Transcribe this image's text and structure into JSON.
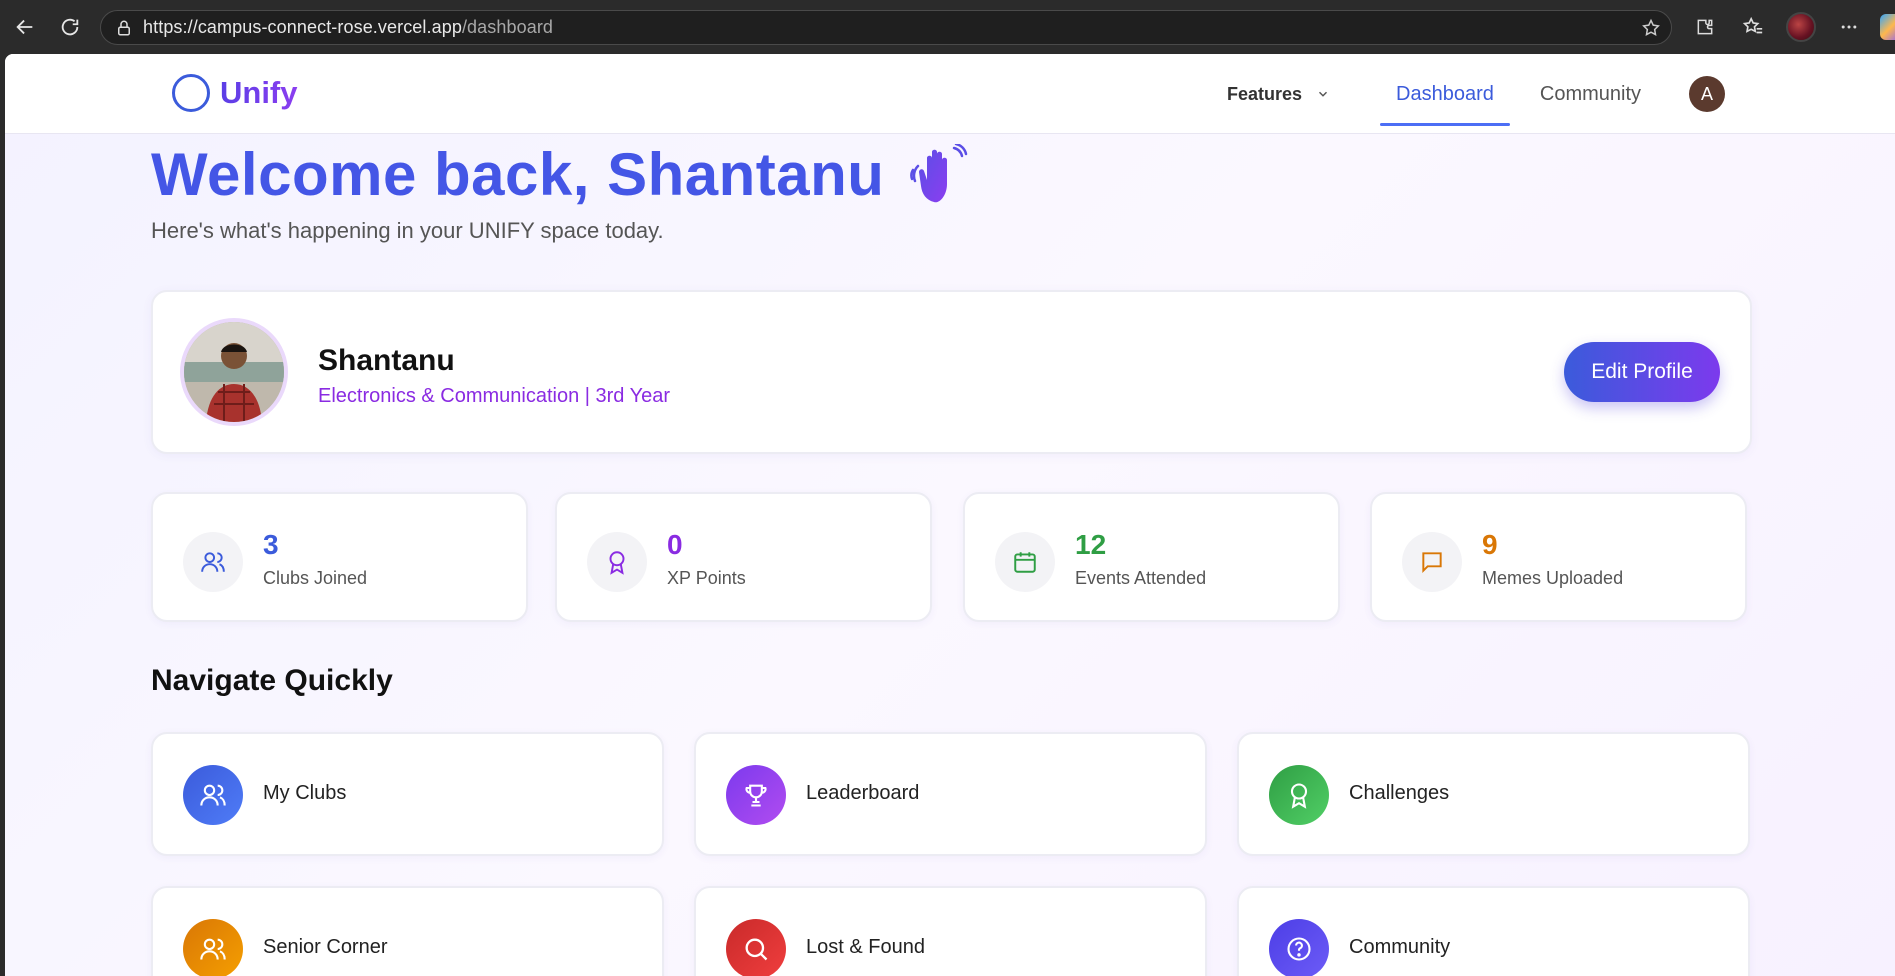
{
  "browser": {
    "url_host": "https://campus-connect-rose.vercel.app",
    "url_path": "/dashboard"
  },
  "nav": {
    "logo": "Unify",
    "features": "Features",
    "dashboard": "Dashboard",
    "community": "Community",
    "avatar_initial": "A"
  },
  "welcome": {
    "title": "Welcome back, Shantanu",
    "subtitle": "Here's what's happening in your UNIFY space today."
  },
  "profile": {
    "name": "Shantanu",
    "details": "Electronics & Communication | 3rd Year",
    "edit_label": "Edit Profile"
  },
  "stats": [
    {
      "value": "3",
      "label": "Clubs Joined",
      "color": "#3b5bdb",
      "icon": "users-icon"
    },
    {
      "value": "0",
      "label": "XP Points",
      "color": "#8a2be2",
      "icon": "award-icon"
    },
    {
      "value": "12",
      "label": "Events Attended",
      "color": "#2f9e44",
      "icon": "calendar-icon"
    },
    {
      "value": "9",
      "label": "Memes Uploaded",
      "color": "#d97706",
      "icon": "message-icon"
    }
  ],
  "quick": {
    "title": "Navigate Quickly",
    "items": [
      {
        "label": "My Clubs",
        "icon": "users-icon",
        "gradient": [
          "#3b5bdb",
          "#4f7cf7"
        ]
      },
      {
        "label": "Leaderboard",
        "icon": "trophy-icon",
        "gradient": [
          "#7c3aed",
          "#b14cf0"
        ]
      },
      {
        "label": "Challenges",
        "icon": "award-icon",
        "gradient": [
          "#2f9e44",
          "#51cf66"
        ]
      },
      {
        "label": "Senior Corner",
        "icon": "users-icon",
        "gradient": [
          "#d97706",
          "#f59f00"
        ]
      },
      {
        "label": "Lost & Found",
        "icon": "search-icon",
        "gradient": [
          "#c92a2a",
          "#f03e3e"
        ]
      },
      {
        "label": "Community",
        "icon": "help-circle-icon",
        "gradient": [
          "#4c3ee6",
          "#6d5cf7"
        ]
      }
    ]
  }
}
